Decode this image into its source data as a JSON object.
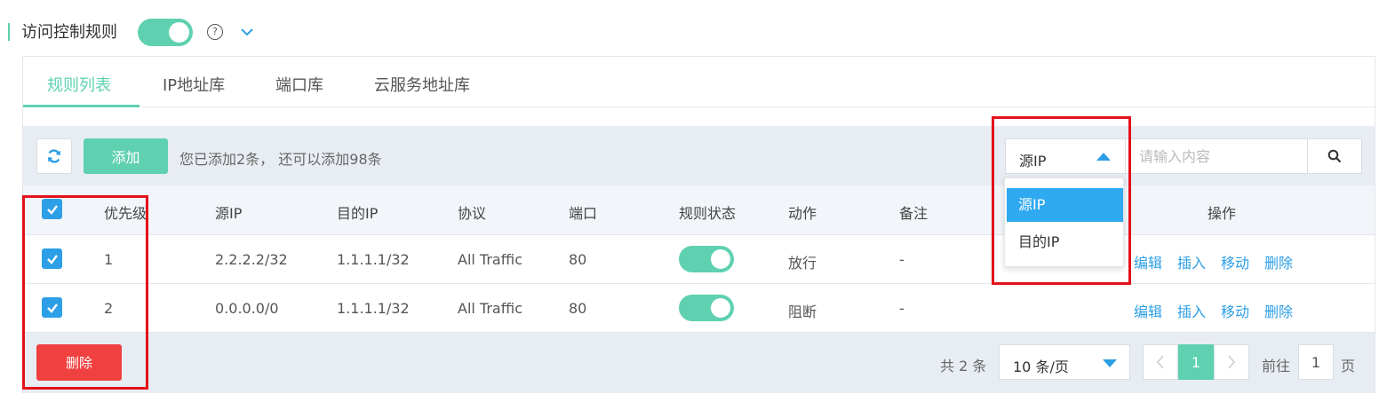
{
  "header": {
    "title": "访问控制规则",
    "toggle_on": true,
    "help_icon": "question-circle-icon",
    "collapse_icon": "chevron-down-icon"
  },
  "tabs": [
    {
      "label": "规则列表",
      "active": true
    },
    {
      "label": "IP地址库",
      "active": false
    },
    {
      "label": "端口库",
      "active": false
    },
    {
      "label": "云服务地址库",
      "active": false
    }
  ],
  "toolbar": {
    "refresh_icon": "refresh-icon",
    "add_label": "添加",
    "info_text": "您已添加2条， 还可以添加98条",
    "search_field": "源IP",
    "search_placeholder": "请输入内容",
    "search_icon": "search-icon"
  },
  "search_dropdown": {
    "options": [
      "源IP",
      "目的IP"
    ],
    "selected": "源IP"
  },
  "table": {
    "columns": [
      "优先级",
      "源IP",
      "目的IP",
      "协议",
      "端口",
      "规则状态",
      "动作",
      "备注",
      "操作"
    ],
    "rows": [
      {
        "priority": "1",
        "src_ip": "2.2.2.2/32",
        "dst_ip": "1.1.1.1/32",
        "protocol": "All Traffic",
        "port": "80",
        "enabled": true,
        "action": "放行",
        "remark": "-",
        "checked": true
      },
      {
        "priority": "2",
        "src_ip": "0.0.0.0/0",
        "dst_ip": "1.1.1.1/32",
        "protocol": "All Traffic",
        "port": "80",
        "enabled": true,
        "action": "阻断",
        "remark": "-",
        "checked": true
      }
    ],
    "row_ops": [
      "编辑",
      "插入",
      "移动",
      "删除"
    ],
    "select_all_checked": true
  },
  "footer": {
    "delete_label": "删除",
    "total_text": "共 2 条",
    "page_size": "10 条/页",
    "current_page": "1",
    "goto_label": "前往",
    "goto_value": "1",
    "page_suffix": "页"
  },
  "colors": {
    "accent": "#5fd1b0",
    "link": "#2d9fe6",
    "danger": "#f04040",
    "highlight": "#e3111b"
  }
}
